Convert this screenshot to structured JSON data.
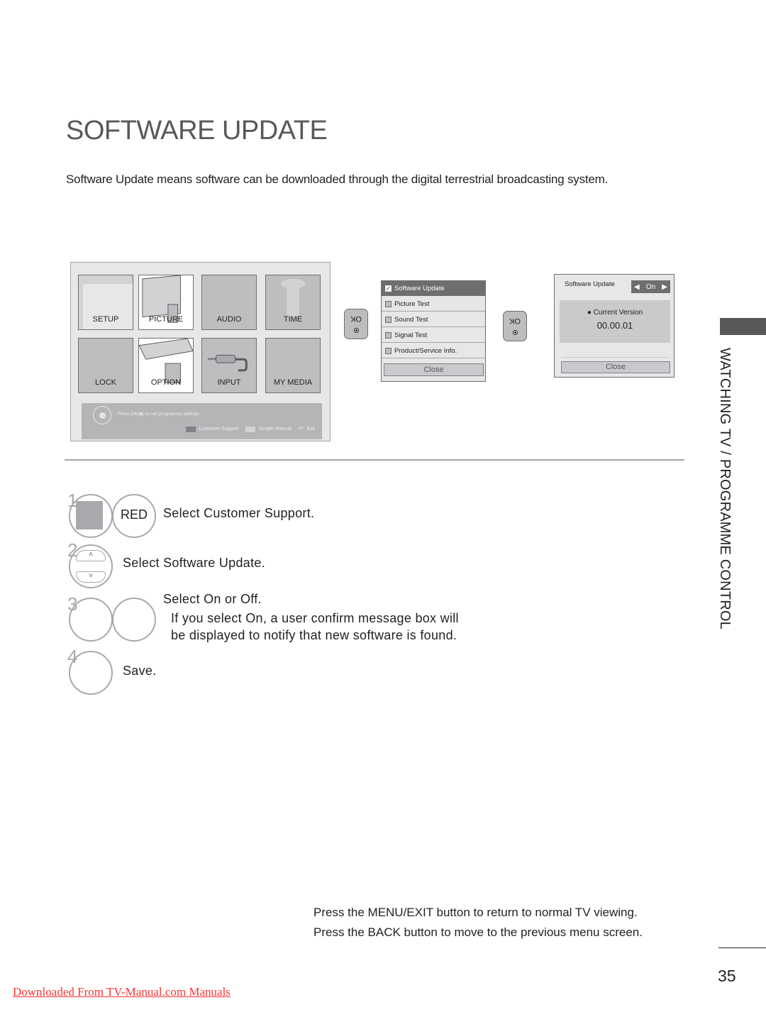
{
  "page": {
    "title": "SOFTWARE UPDATE",
    "intro": "Software Update means software can be downloaded through the digital terrestrial broadcasting system.",
    "page_number": "35",
    "side_tab": "WATCHING TV / PROGRAMME CONTROL",
    "download_link": "Downloaded From TV-Manual.com Manuals"
  },
  "main_menu": {
    "tiles": [
      {
        "label": "SETUP",
        "icon": "setup-icon"
      },
      {
        "label": "PICTURE",
        "icon": "picture-icon"
      },
      {
        "label": "AUDIO",
        "icon": "audio-icon"
      },
      {
        "label": "TIME",
        "icon": "time-icon"
      },
      {
        "label": "LOCK",
        "icon": "lock-icon"
      },
      {
        "label": "OPTION",
        "icon": "option-icon"
      },
      {
        "label": "INPUT",
        "icon": "input-icon"
      },
      {
        "label": "MY MEDIA",
        "icon": "my-media-icon"
      }
    ],
    "hint": "Press OK(◉) to set programme settings.",
    "legend": {
      "customer_support": "Customer Support",
      "simple_manual": "Simple Manual",
      "exit": "Exit"
    }
  },
  "ok_button": {
    "label": "OK"
  },
  "customer_support_menu": {
    "items": [
      {
        "label": "Software Update",
        "selected": true
      },
      {
        "label": "Picture Test",
        "selected": false
      },
      {
        "label": "Sound Test",
        "selected": false
      },
      {
        "label": "Signal Test",
        "selected": false
      },
      {
        "label": "Product/Service Info.",
        "selected": false
      }
    ],
    "close": "Close"
  },
  "software_update_panel": {
    "label": "Software Update",
    "value": "On",
    "left_arrow": "◀",
    "right_arrow": "▶",
    "current_version_label": "● Current Version",
    "current_version": "00.00.01",
    "close": "Close"
  },
  "steps": [
    {
      "number": "1",
      "button": "RED",
      "text": "Select Customer Support."
    },
    {
      "number": "2",
      "text": "Select Software Update."
    },
    {
      "number": "3",
      "text": "Select On or Off.",
      "detail_line1": "If you select On, a user confirm message box will",
      "detail_line2": "be displayed to notify that new software is found."
    },
    {
      "number": "4",
      "text": "Save."
    }
  ],
  "arrows": {
    "up": "˄",
    "down": "˅"
  },
  "notes": [
    "Press the MENU/EXIT button to return to normal TV viewing.",
    "Press the BACK button to move to the previous menu screen."
  ],
  "colors": {
    "title": "#58585a",
    "selected_item": "#6d6e70",
    "panel_bg": "#e6e7e8",
    "link": "#ff3333"
  }
}
